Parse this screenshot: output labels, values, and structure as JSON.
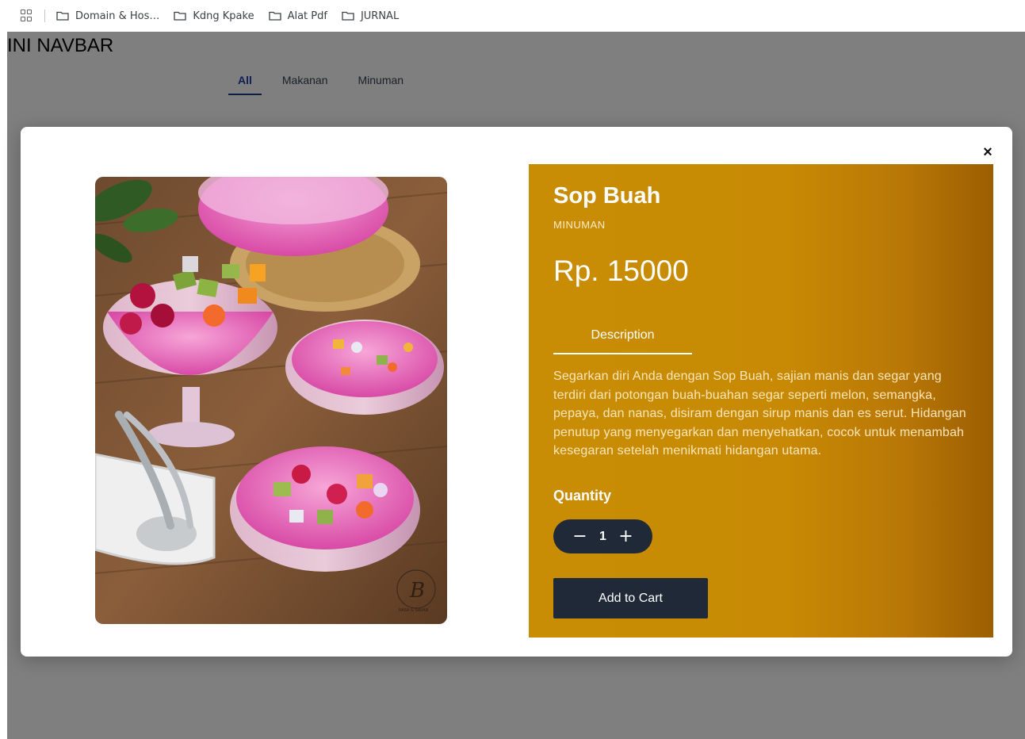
{
  "bookmarks": {
    "items": [
      {
        "label": "Domain & Hos…"
      },
      {
        "label": "Kdng Kpake"
      },
      {
        "label": "Alat Pdf"
      },
      {
        "label": "JURNAL"
      }
    ]
  },
  "navbar": {
    "title": "INI NAVBAR"
  },
  "tabs": [
    {
      "label": "All",
      "active": true
    },
    {
      "label": "Makanan",
      "active": false
    },
    {
      "label": "Minuman",
      "active": false
    }
  ],
  "modal": {
    "close_label": "×",
    "product": {
      "name": "Sop Buah",
      "category": "MINUMAN",
      "price": "Rp. 15000",
      "description_tab": "Description",
      "description": "Segarkan diri Anda dengan Sop Buah, sajian manis dan segar yang terdiri dari potongan buah-buahan segar seperti melon, semangka, pepaya, dan nanas, disiram dengan sirup manis dan es serut. Hidangan penutup yang menyegarkan dan menyehatkan, cocok untuk menambah kesegaran setelah menikmati hidangan utama.",
      "quantity_label": "Quantity",
      "quantity": "1",
      "decrement_label": "−",
      "increment_label": "+",
      "add_to_cart_label": "Add to Cart",
      "watermark_letter": "B",
      "watermark_text": "RASA & SAJIAN"
    }
  },
  "colors": {
    "panel_gold": "#c98d05",
    "panel_dark": "#9c5e02",
    "button_dark": "#1f2937",
    "tab_active": "#1e40af"
  }
}
